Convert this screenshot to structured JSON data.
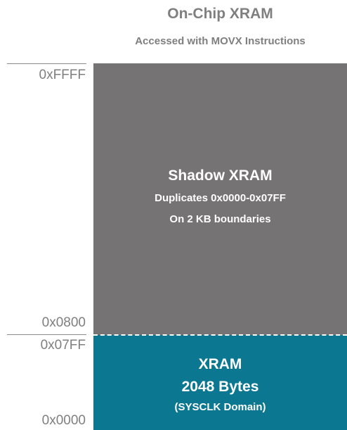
{
  "header": {
    "title": "On-Chip XRAM",
    "subtitle": "Accessed with MOVX Instructions"
  },
  "regions": {
    "shadow": {
      "title": "Shadow XRAM",
      "line1": "Duplicates 0x0000-0x07FF",
      "line2": "On 2 KB boundaries",
      "color": "#767374"
    },
    "xram": {
      "title": "XRAM",
      "size": "2048 Bytes",
      "domain": "(SYSCLK Domain)",
      "color": "#0b7790"
    }
  },
  "addresses": {
    "top": "0xFFFF",
    "shadow_start": "0x0800",
    "xram_end": "0x07FF",
    "bottom": "0x0000"
  }
}
